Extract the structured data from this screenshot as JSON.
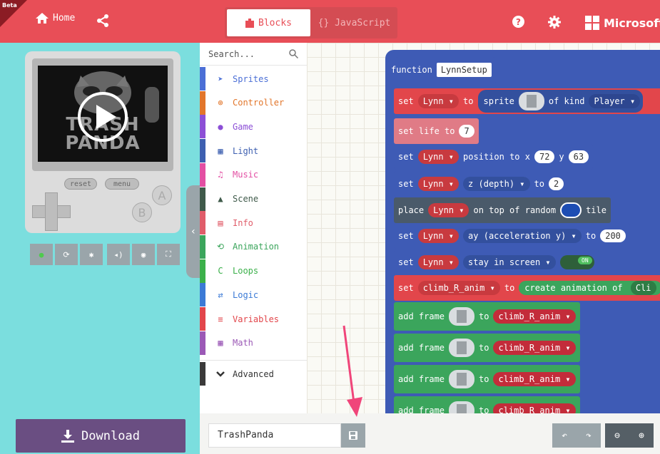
{
  "header": {
    "beta_label": "Beta",
    "home_label": "Home",
    "tabs": {
      "blocks": "Blocks",
      "javascript": "{} JavaScript"
    },
    "brand": "Microsoft",
    "colors": {
      "header_bg": "#e84e57"
    }
  },
  "simulator": {
    "screen_title": "TRASH PANDA",
    "buttons": {
      "reset": "reset",
      "menu": "menu",
      "a": "A",
      "b": "B"
    },
    "tools": [
      "play-icon",
      "restart-icon",
      "debug-icon",
      "sound-icon",
      "screenshot-icon",
      "fullscreen-icon"
    ]
  },
  "download": {
    "label": "Download"
  },
  "toolbox": {
    "search_placeholder": "Search...",
    "categories": [
      {
        "label": "Sprites",
        "color": "#4b6fd6",
        "icon": "sprites-icon"
      },
      {
        "label": "Controller",
        "color": "#e2762b",
        "icon": "controller-icon"
      },
      {
        "label": "Game",
        "color": "#8c4fd6",
        "icon": "game-icon"
      },
      {
        "label": "Light",
        "color": "#3d5fb0",
        "icon": "light-icon"
      },
      {
        "label": "Music",
        "color": "#e34fa3",
        "icon": "music-icon"
      },
      {
        "label": "Scene",
        "color": "#3f5a4a",
        "icon": "scene-icon"
      },
      {
        "label": "Info",
        "color": "#e05d6a",
        "icon": "info-icon"
      },
      {
        "label": "Animation",
        "color": "#3ba55c",
        "icon": "animation-icon"
      },
      {
        "label": "Loops",
        "color": "#3bb04a",
        "icon": "loops-icon"
      },
      {
        "label": "Logic",
        "color": "#3b7ad6",
        "icon": "logic-icon"
      },
      {
        "label": "Variables",
        "color": "#e2464b",
        "icon": "variables-icon"
      },
      {
        "label": "Math",
        "color": "#9b59b6",
        "icon": "math-icon"
      }
    ],
    "advanced": "Advanced"
  },
  "workspace": {
    "function_label": "function",
    "function_name": "LynnSetup",
    "blocks": {
      "b1": {
        "w1": "set",
        "w2": "Lynn ▾",
        "w3": "to",
        "w4": "sprite",
        "w5": "of kind",
        "w6": "Player ▾"
      },
      "b2": {
        "w1": "set life to",
        "w2": "7"
      },
      "b3": {
        "w1": "set",
        "w2": "Lynn ▾",
        "w3": "position to x",
        "w4": "72",
        "w5": "y",
        "w6": "63"
      },
      "b4": {
        "w1": "set",
        "w2": "Lynn ▾",
        "w3": "z (depth) ▾",
        "w4": "to",
        "w5": "2"
      },
      "b5": {
        "w1": "place",
        "w2": "Lynn ▾",
        "w3": "on top of random",
        "w4": "tile"
      },
      "b6": {
        "w1": "set",
        "w2": "Lynn ▾",
        "w3": "ay (acceleration y) ▾",
        "w4": "to",
        "w5": "200"
      },
      "b7": {
        "w1": "set",
        "w2": "Lynn ▾",
        "w3": "stay in screen ▾",
        "w4": "ON"
      },
      "b8": {
        "w1": "set",
        "w2": "climb_R_anim ▾",
        "w3": "to",
        "w4": "create animation of",
        "w5": "Cli"
      },
      "b9": {
        "w1": "add frame",
        "w2": "to",
        "w3": "climb_R_anim ▾"
      },
      "b10": {
        "w1": "add frame",
        "w2": "to",
        "w3": "climb_R_anim ▾"
      },
      "b11": {
        "w1": "add frame",
        "w2": "to",
        "w3": "climb_R_anim ▾"
      },
      "b12": {
        "w1": "add frame",
        "w2": "to",
        "w3": "climb_R_anim ▾"
      }
    }
  },
  "bottom": {
    "filename": "TrashPanda"
  }
}
